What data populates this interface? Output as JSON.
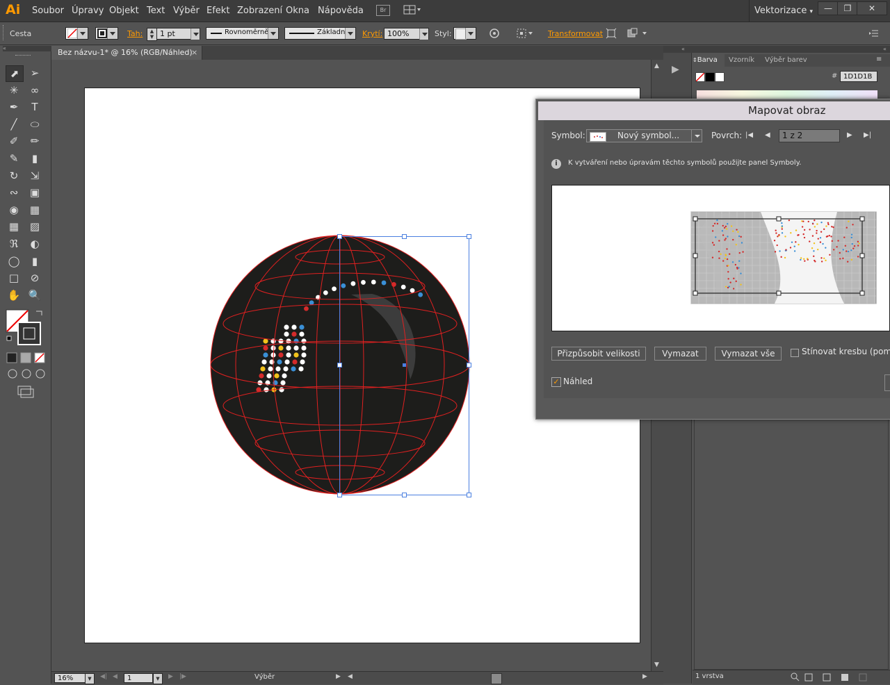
{
  "app": {
    "logo": "Ai",
    "menu": [
      "Soubor",
      "Úpravy",
      "Objekt",
      "Text",
      "Výběr",
      "Efekt",
      "Zobrazení",
      "Okna",
      "Nápověda"
    ],
    "bridge": "Br",
    "workspace": "Vektorizace"
  },
  "control": {
    "object_type": "Cesta",
    "stroke_label": "Tah:",
    "stroke_weight": "1 pt",
    "profile": "Rovnoměrně",
    "brush": "Základní",
    "opacity_label": "Krytí:",
    "opacity": "100%",
    "style_label": "Styl:",
    "transform": "Transformovat"
  },
  "document": {
    "tab_title": "Bez názvu-1* @ 16% (RGB/Náhled)",
    "zoom": "16%",
    "artboard": "1",
    "status": "Výběr"
  },
  "panel": {
    "tabs": [
      "Barva",
      "Vzorník",
      "Výběr barev"
    ],
    "hex_label": "#",
    "hex": "1D1D1B",
    "layers_count": "1 vrstva"
  },
  "dialog": {
    "title": "Mapovat obraz",
    "symbol_label": "Symbol:",
    "symbol_value": "Nový symbol...",
    "surface_label": "Povrch:",
    "surface_value": "1 z 2",
    "info": "K vytváření nebo úpravám těchto symbolů použijte panel Symboly.",
    "fit_button": "Přizpůsobit velikosti",
    "clear_button": "Vymazat",
    "clear_all_button": "Vymazat vše",
    "shade_checkbox": "Stínovat kresbu (pomal",
    "preview_checkbox": "Náhled",
    "preview_checked": true
  },
  "colors": {
    "accent": "#ff9a00",
    "wire": "#e02020",
    "sel": "#4a7fe0",
    "globe": "#1d1d1b"
  }
}
